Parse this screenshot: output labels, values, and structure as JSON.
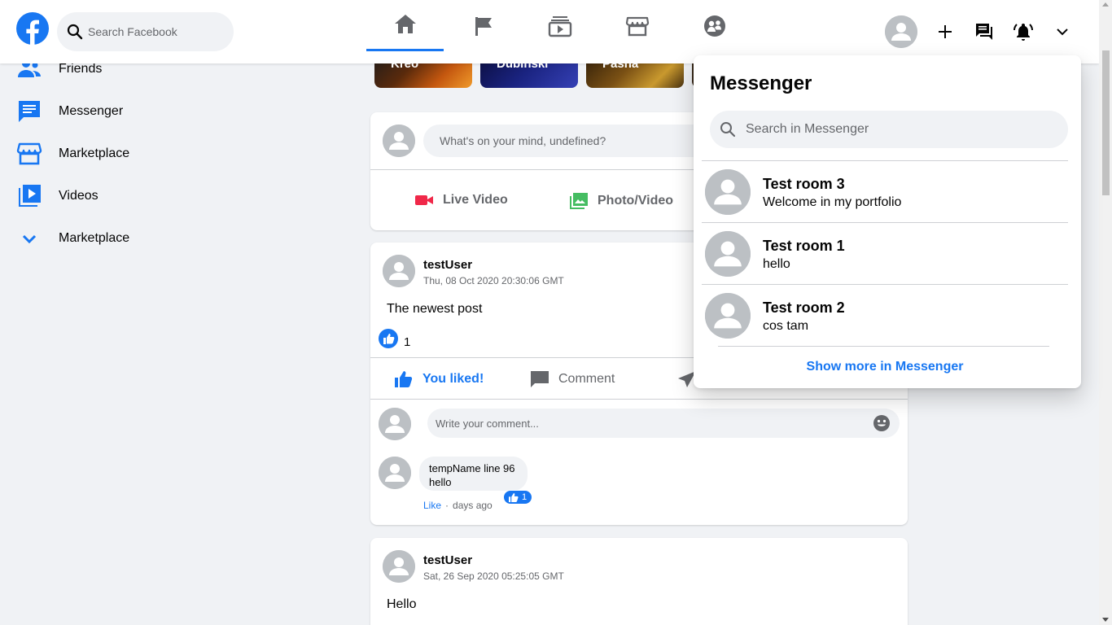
{
  "header": {
    "search_placeholder": "Search Facebook",
    "nav_tabs": [
      "home-icon",
      "flag-icon",
      "watch-icon",
      "marketplace-icon",
      "groups-icon"
    ],
    "active_tab": "home",
    "accent": "#1877f2"
  },
  "sidebar": {
    "items": [
      {
        "label": "Friends",
        "icon": "friends-icon"
      },
      {
        "label": "Messenger",
        "icon": "messenger-icon"
      },
      {
        "label": "Marketplace",
        "icon": "marketplace-icon"
      },
      {
        "label": "Videos",
        "icon": "videos-icon"
      },
      {
        "label": "Marketplace",
        "icon": "chevron-down-icon"
      }
    ]
  },
  "stories": [
    {
      "name": "Kreo"
    },
    {
      "name": "Dubinski"
    },
    {
      "name": "Pasha"
    }
  ],
  "composer": {
    "placeholder": "What's on your mind, undefined?",
    "live_video": "Live Video",
    "photo_video": "Photo/Video"
  },
  "posts": [
    {
      "user": "testUser",
      "date": "Thu, 08 Oct 2020 20:30:06 GMT",
      "text": "The newest post",
      "likes": "1",
      "liked_label": "You liked!",
      "comment_label": "Comment",
      "comment_placeholder": "Write your comment...",
      "comment": {
        "author": "tempName line 96",
        "text": "hello",
        "like_label": "Like",
        "time": "days ago",
        "likes": "1"
      }
    },
    {
      "user": "testUser",
      "date": "Sat, 26 Sep 2020 05:25:05 GMT",
      "text": "Hello"
    }
  ],
  "messenger": {
    "title": "Messenger",
    "search_placeholder": "Search in Messenger",
    "rooms": [
      {
        "name": "Test room 3",
        "last": "Welcome in my portfolio"
      },
      {
        "name": "Test room 1",
        "last": "hello"
      },
      {
        "name": "Test room 2",
        "last": "cos tam"
      }
    ],
    "show_more": "Show more in Messenger"
  }
}
